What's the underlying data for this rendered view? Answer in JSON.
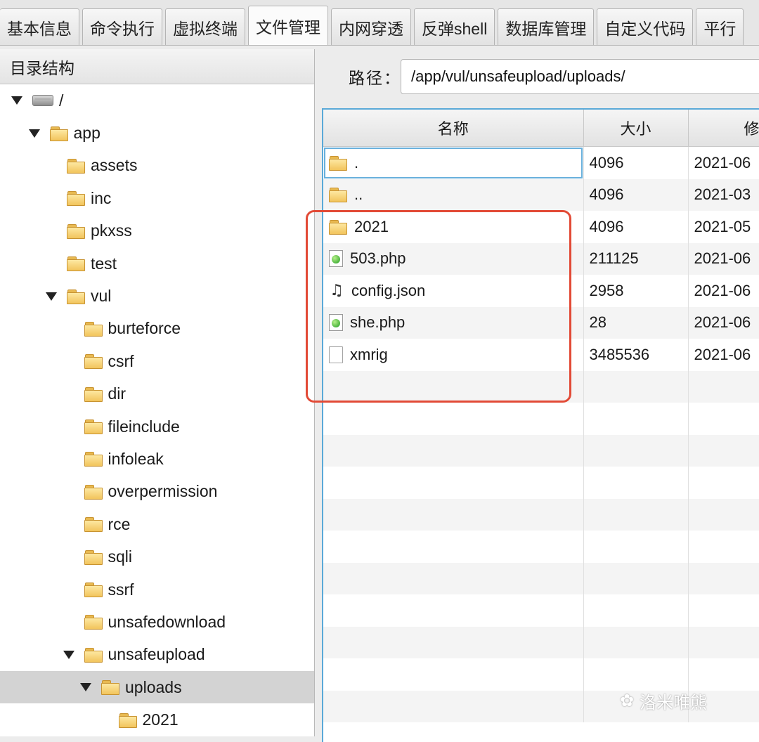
{
  "tabs": [
    {
      "label": "基本信息"
    },
    {
      "label": "命令执行"
    },
    {
      "label": "虚拟终端"
    },
    {
      "label": "文件管理",
      "active": true
    },
    {
      "label": "内网穿透"
    },
    {
      "label": "反弹shell"
    },
    {
      "label": "数据库管理"
    },
    {
      "label": "自定义代码"
    },
    {
      "label": "平行"
    }
  ],
  "tree": {
    "header": "目录结构",
    "items": [
      {
        "label": "/",
        "level": 0,
        "expanded": true,
        "icon": "drive-icon"
      },
      {
        "label": "app",
        "level": 1,
        "expanded": true,
        "icon": "folder-icon"
      },
      {
        "label": "assets",
        "level": 2,
        "icon": "folder-icon"
      },
      {
        "label": "inc",
        "level": 2,
        "icon": "folder-icon"
      },
      {
        "label": "pkxss",
        "level": 2,
        "icon": "folder-icon"
      },
      {
        "label": "test",
        "level": 2,
        "icon": "folder-icon"
      },
      {
        "label": "vul",
        "level": 2,
        "expanded": true,
        "icon": "folder-icon"
      },
      {
        "label": "burteforce",
        "level": 3,
        "icon": "folder-icon"
      },
      {
        "label": "csrf",
        "level": 3,
        "icon": "folder-icon"
      },
      {
        "label": "dir",
        "level": 3,
        "icon": "folder-icon"
      },
      {
        "label": "fileinclude",
        "level": 3,
        "icon": "folder-icon"
      },
      {
        "label": "infoleak",
        "level": 3,
        "icon": "folder-icon"
      },
      {
        "label": "overpermission",
        "level": 3,
        "icon": "folder-icon"
      },
      {
        "label": "rce",
        "level": 3,
        "icon": "folder-icon"
      },
      {
        "label": "sqli",
        "level": 3,
        "icon": "folder-icon"
      },
      {
        "label": "ssrf",
        "level": 3,
        "icon": "folder-icon"
      },
      {
        "label": "unsafedownload",
        "level": 3,
        "icon": "folder-icon"
      },
      {
        "label": "unsafeupload",
        "level": 3,
        "expanded": true,
        "icon": "folder-icon"
      },
      {
        "label": "uploads",
        "level": 4,
        "expanded": true,
        "selected": true,
        "icon": "folder-icon"
      },
      {
        "label": "2021",
        "level": 5,
        "icon": "folder-icon"
      }
    ]
  },
  "path": {
    "label": "路径：",
    "value": "/app/vul/unsafeupload/uploads/"
  },
  "table": {
    "columns": [
      "名称",
      "大小",
      "修"
    ],
    "rows": [
      {
        "name": ".",
        "size": "4096",
        "date": "2021-06",
        "icon": "folder-icon"
      },
      {
        "name": "..",
        "size": "4096",
        "date": "2021-03",
        "icon": "folder-icon"
      },
      {
        "name": "2021",
        "size": "4096",
        "date": "2021-05",
        "icon": "folder-icon"
      },
      {
        "name": "503.php",
        "size": "211125",
        "date": "2021-06",
        "icon": "php-file-icon"
      },
      {
        "name": "config.json",
        "size": "2958",
        "date": "2021-06",
        "icon": "script-file-icon"
      },
      {
        "name": "she.php",
        "size": "28",
        "date": "2021-06",
        "icon": "php-file-icon"
      },
      {
        "name": "xmrig",
        "size": "3485536",
        "date": "2021-06",
        "icon": "plain-file-icon"
      }
    ],
    "empty_rows": 11
  },
  "highlight_color": "#e24a36",
  "watermark": "洛米唯熊"
}
